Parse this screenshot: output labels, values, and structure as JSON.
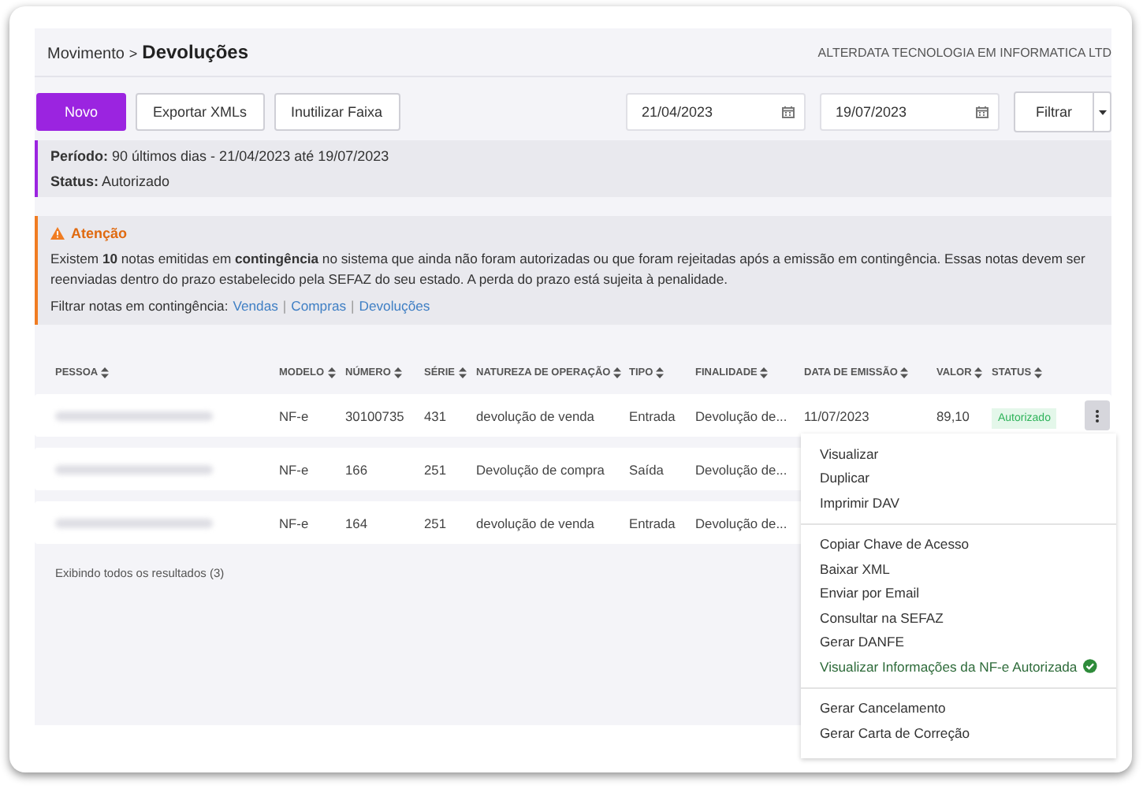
{
  "breadcrumb": {
    "parent": "Movimento",
    "separator": ">",
    "current": "Devoluções"
  },
  "company": "ALTERDATA TECNOLOGIA EM INFORMATICA LTD",
  "toolbar": {
    "buttons": [
      {
        "label": "Novo",
        "kind": "primary"
      },
      {
        "label": "Exportar XMLs",
        "kind": "secondary"
      },
      {
        "label": "Inutilizar Faixa",
        "kind": "secondary"
      }
    ],
    "date_from": "21/04/2023",
    "date_to": "19/07/2023",
    "filter_button": "Filtrar"
  },
  "summary": [
    {
      "label": "Período:",
      "value": "90 últimos dias - 21/04/2023 até 19/07/2023"
    },
    {
      "label": "Status:",
      "value": "Autorizado"
    }
  ],
  "alert": {
    "title": "Atenção",
    "message": "Existem **10** notas emitidas em **contingência** no sistema que ainda não foram autorizadas ou que foram rejeitadas após a emissão em contingência. Essas notas devem ser reenviadas dentro do prazo estabelecido pela SEFAZ do seu estado. A perda do prazo está sujeita à penalidade.",
    "filter_label": "Filtrar notas em contingência:",
    "links": [
      "Vendas",
      "Compras",
      "Devoluções"
    ],
    "link_separator": "|"
  },
  "table": {
    "columns": [
      "PESSOA",
      "MODELO",
      "NÚMERO",
      "SÉRIE",
      "NATUREZA DE OPERAÇÃO",
      "TIPO",
      "FINALIDADE",
      "DATA DE EMISSÃO",
      "VALOR",
      "STATUS"
    ],
    "rows": [
      {
        "modelo": "NF-e",
        "numero": "30100735",
        "serie": "431",
        "natureza": "devolução de venda",
        "tipo": "Entrada",
        "finalidade": "Devolução de...",
        "data": "11/07/2023",
        "valor": "89,10",
        "status": "Autorizado",
        "menu_open": true
      },
      {
        "modelo": "NF-e",
        "numero": "166",
        "serie": "251",
        "natureza": "Devolução de compra",
        "tipo": "Saída",
        "finalidade": "Devolução de..."
      },
      {
        "modelo": "NF-e",
        "numero": "164",
        "serie": "251",
        "natureza": "devolução de venda",
        "tipo": "Entrada",
        "finalidade": "Devolução de..."
      }
    ]
  },
  "results_text": "Exibindo todos os resultados (3)",
  "menu": [
    {
      "kind": "action",
      "label": "Visualizar"
    },
    {
      "kind": "action",
      "label": "Duplicar"
    },
    {
      "kind": "action",
      "label": "Imprimir DAV"
    },
    {
      "kind": "divider"
    },
    {
      "kind": "action",
      "label": "Copiar Chave de Acesso"
    },
    {
      "kind": "action",
      "label": "Baixar XML"
    },
    {
      "kind": "action",
      "label": "Enviar por Email"
    },
    {
      "kind": "action",
      "label": "Consultar na SEFAZ"
    },
    {
      "kind": "action",
      "label": "Gerar DANFE"
    },
    {
      "kind": "verified",
      "label": "Visualizar Informações da NF-e Autorizada"
    },
    {
      "kind": "divider"
    },
    {
      "kind": "action",
      "label": "Gerar Cancelamento"
    },
    {
      "kind": "action",
      "label": "Gerar Carta de Correção"
    }
  ]
}
